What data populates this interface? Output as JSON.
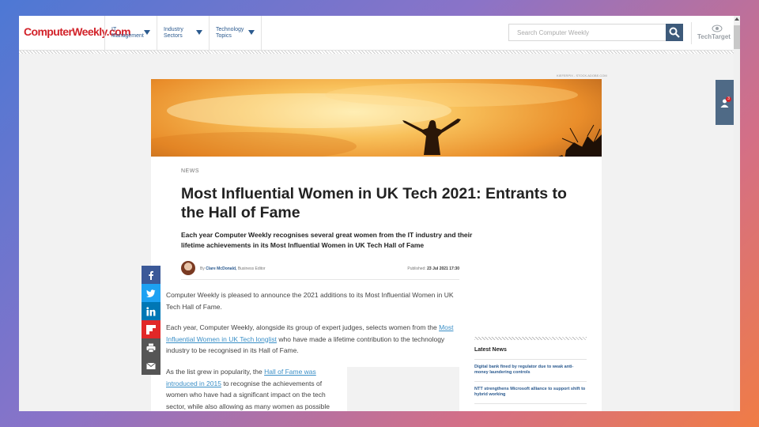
{
  "header": {
    "logo": "ComputerWeekly.com",
    "nav": [
      {
        "label": "IT Management"
      },
      {
        "label": "Industry Sectors"
      },
      {
        "label": "Technology Topics"
      }
    ],
    "search_placeholder": "Search Computer Weekly",
    "partner_logo": "TechTarget",
    "notifications_count": "3"
  },
  "article": {
    "image_credit": "KIEFERPIX - STOCK.ADOBE.COM",
    "kicker": "NEWS",
    "headline": "Most Influential Women in UK Tech 2021: Entrants to the Hall of Fame",
    "standfirst": "Each year Computer Weekly recognises several great women from the IT industry and their lifetime achievements in its Most Influential Women in UK Tech Hall of Fame",
    "byline_prefix": "By",
    "author": "Clare McDonald,",
    "author_role": "Business Editor",
    "published_label": "Published:",
    "published_date": "23 Jul 2021 17:30",
    "p1": "Computer Weekly is pleased to announce the 2021 additions to its Most Influential Women in UK Tech Hall of Fame.",
    "p2_a": "Each year, Computer Weekly, alongside its group of expert judges, selects women from the",
    "p2_link": "Most Influential Women in UK Tech longlist",
    "p2_b": "who have made a lifetime contribution to the technology industry to be recognised in its Hall of Fame.",
    "p3_a": "As the list grew in popularity, the",
    "p3_link": "Hall of Fame was introduced in 2015",
    "p3_b": "to recognise the achievements of women who have had a significant impact on the tech sector, while also allowing as many women as possible"
  },
  "latest_news": {
    "title": "Latest News",
    "items": [
      "Digital bank fined by regulator due to weak anti-money laundering controls",
      "NTT strengthens Microsoft alliance to support shift to hybrid working"
    ]
  },
  "share": {
    "colors": [
      "#3b5998",
      "#1da1f2",
      "#0077b5",
      "#e12828",
      "#555555",
      "#555555"
    ],
    "icons": [
      "facebook-icon",
      "twitter-icon",
      "linkedin-icon",
      "flipboard-icon",
      "print-icon",
      "email-icon"
    ]
  }
}
